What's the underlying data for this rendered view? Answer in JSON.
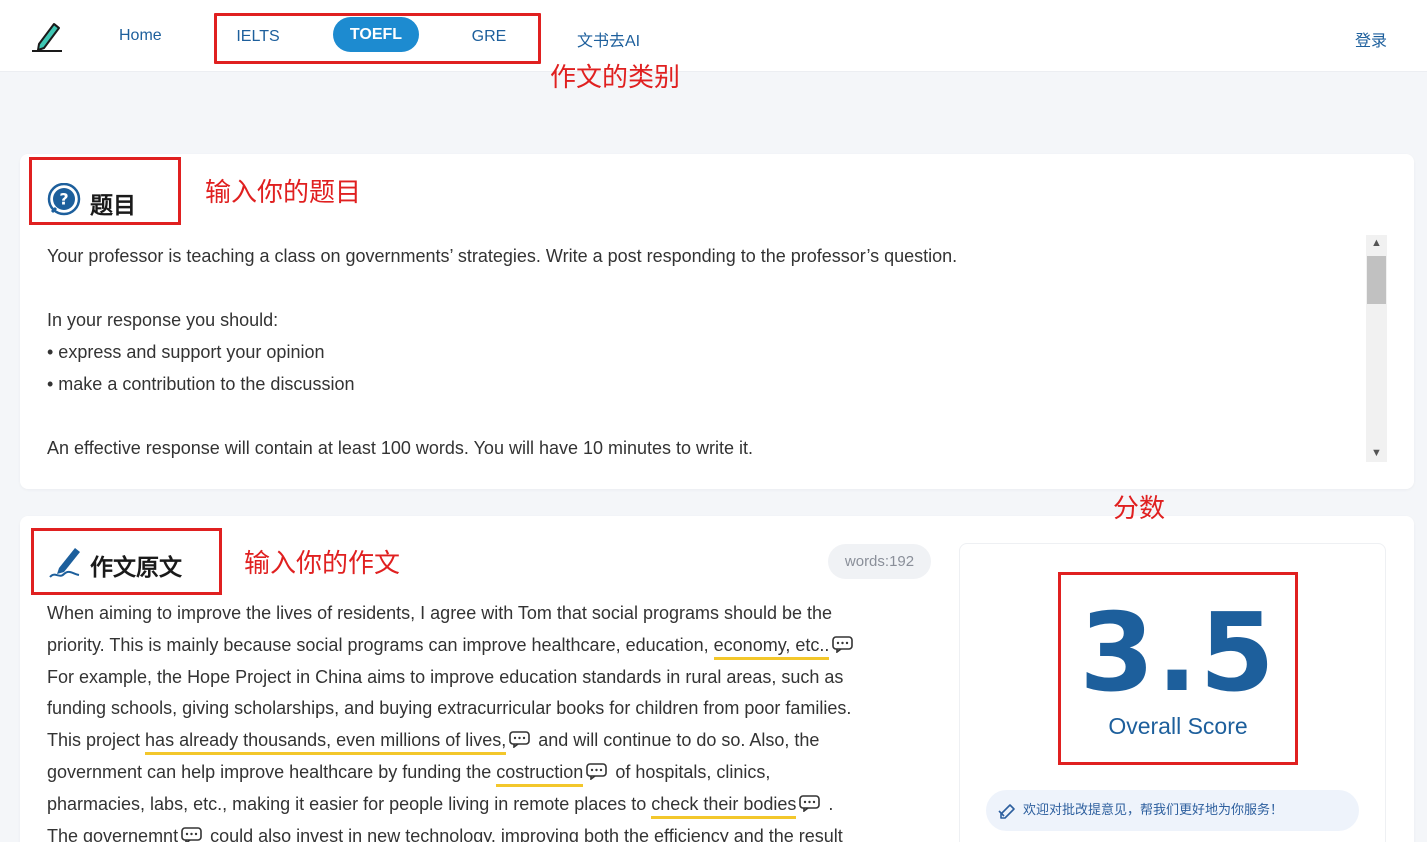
{
  "nav": {
    "home": "Home",
    "tabs": [
      "IELTS",
      "TOEFL",
      "GRE"
    ],
    "active_tab": "TOEFL",
    "wenshu": "文书去AI",
    "login": "登录"
  },
  "annotations": {
    "category": "作文的类别",
    "topic": "输入你的题目",
    "essay": "输入你的作文",
    "score": "分数"
  },
  "topic": {
    "title": "题目",
    "lines": [
      "Your professor is teaching a class on governments’ strategies. Write a post responding to the professor’s question.",
      "",
      "In your response you should:",
      "• express and support your opinion",
      "• make a contribution to the discussion",
      "",
      "An effective response will contain at least 100 words. You will have 10 minutes to write it."
    ]
  },
  "essay": {
    "title": "作文原文",
    "word_count": "words:192",
    "segments": {
      "l1": "When aiming to improve the lives of residents, I agree with Tom that social programs should be the",
      "l2a": "priority. This is mainly because social programs can improve healthcare, education, ",
      "l2h": "economy, etc..",
      "l3": "For example, the Hope Project in China aims to improve education standards in rural areas, such as",
      "l4": "funding schools, giving scholarships, and buying extracurricular books for children from poor families.",
      "l5a": "This project ",
      "l5h": "has already thousands, even millions of lives,",
      "l5b": " and will continue to do so. Also, the",
      "l6a": "government can help improve healthcare by funding the ",
      "l6h": "costruction",
      "l6b": " of hospitals, clinics,",
      "l7a": "pharmacies, labs, etc., making it easier for people living in remote places to ",
      "l7h": "check their bodies",
      "l7b": " .",
      "l8a": "The governemnt",
      "l8b": " could also invest in new technology, improving both the efficiency and the result"
    }
  },
  "score": {
    "value": "3.5",
    "label": "Overall Score",
    "feedback": "欢迎对批改提意见，帮我们更好地为你服务！"
  },
  "colors": {
    "brand": "#1d5f9c",
    "active_tab": "#1d8bd0",
    "annotation": "#e02020",
    "highlight": "#f3c72b"
  }
}
